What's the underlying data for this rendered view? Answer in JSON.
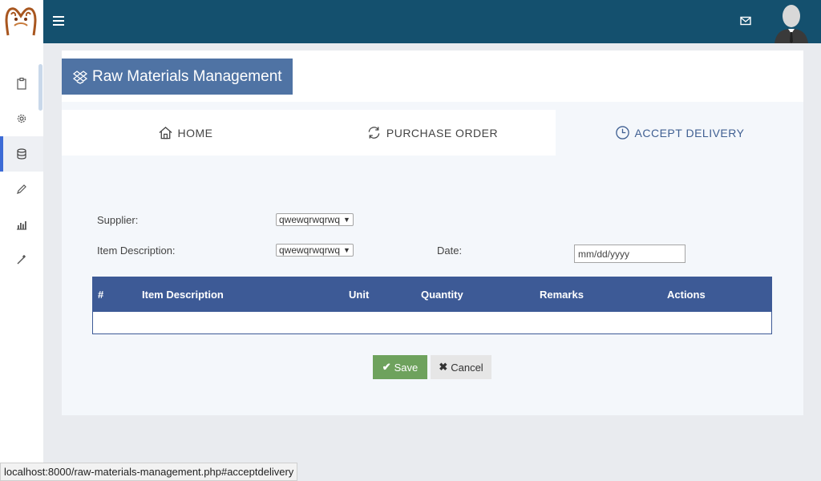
{
  "header": {
    "menu_icon": "hamburger-icon",
    "mail_icon": "envelope-icon",
    "avatar_icon": "user-avatar"
  },
  "sidebar": {
    "items": [
      {
        "icon": "clipboard-icon"
      },
      {
        "icon": "gear-icon"
      },
      {
        "icon": "database-icon",
        "active": true
      },
      {
        "icon": "pencil-icon"
      },
      {
        "icon": "bar-chart-icon"
      },
      {
        "icon": "magic-wand-icon"
      }
    ]
  },
  "page": {
    "title": "Raw Materials Management",
    "title_icon": "dropbox-icon"
  },
  "tabs": [
    {
      "label": "HOME",
      "icon": "home-icon"
    },
    {
      "label": "PURCHASE ORDER",
      "icon": "refresh-icon"
    },
    {
      "label": "ACCEPT DELIVERY",
      "icon": "clock-icon",
      "active": true
    }
  ],
  "form": {
    "supplier_label": "Supplier:",
    "supplier_value": "qwewqrwqrwq",
    "item_label": "Item Description:",
    "item_value": "qwewqrwqrwq",
    "date_label": "Date:",
    "date_placeholder": "mm/dd/yyyy"
  },
  "table": {
    "columns": [
      "#",
      "Item Description",
      "Unit",
      "Quantity",
      "Remarks",
      "Actions"
    ],
    "rows": []
  },
  "buttons": {
    "save": "Save",
    "cancel": "Cancel"
  },
  "status_url": "localhost:8000/raw-materials-management.php#acceptdelivery",
  "colors": {
    "topbar": "#14506e",
    "title_box": "#4f73a4",
    "table_header": "#3d5a96",
    "save": "#6ea25d",
    "active_tab_text": "#3f5f92"
  }
}
